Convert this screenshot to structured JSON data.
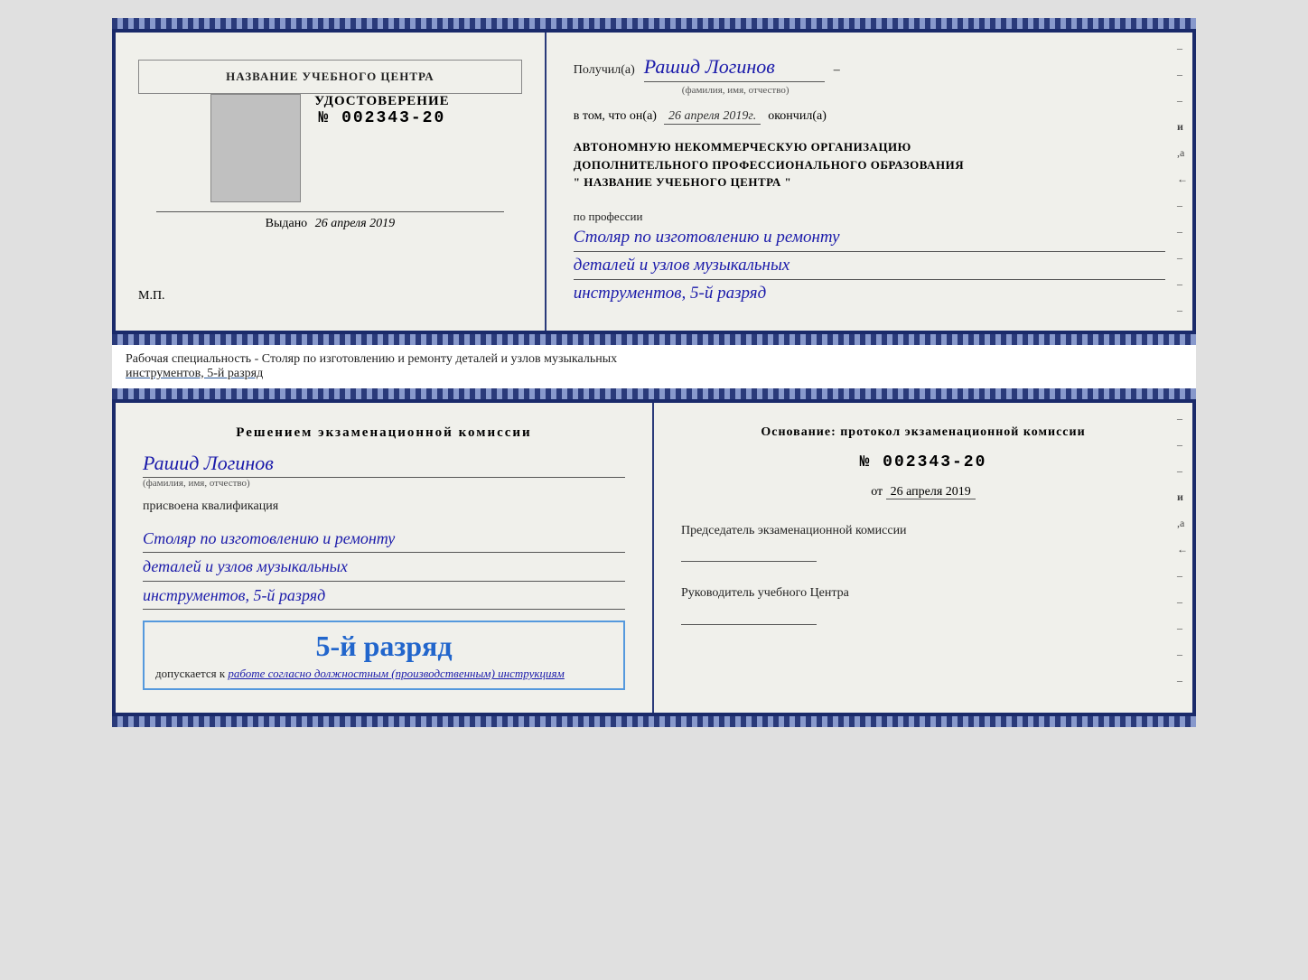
{
  "page": {
    "background": "#d8d8d8"
  },
  "topCertificate": {
    "left": {
      "centerName": "НАЗВАНИЕ УЧЕБНОГО ЦЕНТРА",
      "docTitle": "УДОСТОВЕРЕНИЕ",
      "docNumber": "№ 002343-20",
      "issuedLabel": "Выдано",
      "issuedDate": "26 апреля 2019",
      "mp": "М.П."
    },
    "right": {
      "receivedLabel": "Получил(а)",
      "recipientName": "Рашид Логинов",
      "recipientSubtext": "(фамилия, имя, отчество)",
      "dateLabel": "в том, что он(а)",
      "dateValue": "26 апреля 2019г.",
      "finishedLabel": "окончил(а)",
      "orgLine1": "АВТОНОМНУЮ НЕКОММЕРЧЕСКУЮ ОРГАНИЗАЦИЮ",
      "orgLine2": "ДОПОЛНИТЕЛЬНОГО ПРОФЕССИОНАЛЬНОГО ОБРАЗОВАНИЯ",
      "orgLine3": "\" НАЗВАНИЕ УЧЕБНОГО ЦЕНТРА \"",
      "professionLabel": "по профессии",
      "professionLine1": "Столяр по изготовлению и ремонту",
      "professionLine2": "деталей и узлов музыкальных",
      "professionLine3": "инструментов, 5-й разряд"
    }
  },
  "specialtyText": {
    "line1": "Рабочая специальность - Столяр по изготовлению и ремонту деталей и узлов музыкальных",
    "line2": "инструментов, 5-й разряд"
  },
  "bottomDocument": {
    "left": {
      "commissionTitle": "Решением экзаменационной комиссии",
      "personName": "Рашид Логинов",
      "personSubtext": "(фамилия, имя, отчество)",
      "assignedLabel": "присвоена квалификация",
      "profLine1": "Столяр по изготовлению и ремонту",
      "profLine2": "деталей и узлов музыкальных",
      "profLine3": "инструментов, 5-й разряд",
      "rankHighlight": "5-й разряд",
      "admitLabel": "допускается к",
      "admitValue": "работе согласно должностным (производственным) инструкциям"
    },
    "right": {
      "basisLabel": "Основание: протокол экзаменационной комиссии",
      "protocolNumber": "№ 002343-20",
      "fromLabel": "от",
      "fromDate": "26 апреля 2019",
      "chairmanTitle": "Председатель экзаменационной комиссии",
      "directorTitle": "Руководитель учебного Центра",
      "rightMarks": [
        "–",
        "–",
        "–",
        "и",
        "а",
        "←",
        "–",
        "–",
        "–",
        "–",
        "–"
      ]
    }
  }
}
